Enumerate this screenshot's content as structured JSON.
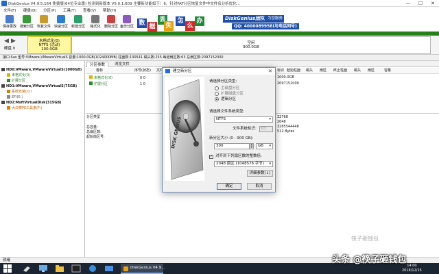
{
  "window": {
    "title": "DiskGenius V4.9.5.164 免费版(64位专业版) 检测到新版本 V5.0.1.609 主要新功能如下：6、针对FAT分区恢复文件中文件名分析优化…",
    "minimize": "—",
    "maximize": "☐",
    "close": "✕"
  },
  "menu": [
    "文件(F)",
    "硬盘(D)",
    "分区(P)",
    "工具(T)",
    "查看(V)",
    "帮助(H)"
  ],
  "toolbar": [
    {
      "label": "保存更改",
      "icon": "save-icon",
      "color": "#4a7bd0"
    },
    {
      "label": "搜索分区",
      "icon": "search-icon",
      "color": "#3a9a3a"
    },
    {
      "label": "恢复文件",
      "icon": "recover-icon",
      "color": "#c89a2a"
    },
    {
      "label": "快速分区",
      "icon": "quick-partition-icon",
      "color": "#2c7fd0"
    },
    {
      "label": "新建分区",
      "icon": "new-partition-icon",
      "color": "#2ca06a"
    },
    {
      "label": "格式化",
      "icon": "format-icon",
      "color": "#777777"
    },
    {
      "label": "删除分区",
      "icon": "delete-icon",
      "color": "#d04040"
    },
    {
      "label": "备份分区",
      "icon": "backup-icon",
      "color": "#8a5ac0"
    }
  ],
  "banner": {
    "chars": [
      "数",
      "据",
      "丢",
      "失",
      "怎",
      "么",
      "办"
    ],
    "char_colors": [
      "#1e4bb0",
      "#d22a2a",
      "#1e8a3a",
      "#e0a010",
      "#1e4bb0",
      "#d22a2a",
      "#1e8a3a"
    ],
    "brand": "DiskGenius团队",
    "slogan": "为您服务",
    "qq": "QQ: 4000089958(与电话同号)"
  },
  "diskbar": {
    "label": "硬盘 0",
    "partition_used": {
      "line1": "未格式化(0)",
      "line2": "NTFS (活动)",
      "line3": "100.0GB"
    },
    "partition_free": {
      "line1": "空闲",
      "line2": "900.0GB"
    },
    "info": "接口:Sas  型号:VMware,VMwareVirtualS  容量:1000.0GB(1024000MB)  柱面数:130541  磁头数:255  每道扇区数:63  总扇区数:2097152000"
  },
  "tree": [
    {
      "text": "HD0:VMware,VMwareVirtualS(1000GB)",
      "indent": 0,
      "color": "#111111",
      "bold": true
    },
    {
      "text": "未格式化(0)",
      "indent": 1,
      "color": "#2a7a2a",
      "bold": false
    },
    {
      "text": "扩展分区",
      "indent": 1,
      "color": "#2a7a2a",
      "bold": false
    },
    {
      "text": "HD1:VMware,VMwareVirtualS(75GB)",
      "indent": 0,
      "color": "#111111",
      "bold": true
    },
    {
      "text": "系统安装(D:)",
      "indent": 1,
      "color": "#c06000",
      "bold": false
    },
    {
      "text": "EFI(E:)",
      "indent": 1,
      "color": "#555555",
      "bold": false
    },
    {
      "text": "HD2:MsftVirtualDisk(315GB)",
      "indent": 0,
      "color": "#111111",
      "bold": true
    },
    {
      "text": "大白菜PE工具盘(F:)",
      "indent": 1,
      "color": "#c06000",
      "bold": false
    }
  ],
  "rtabs": [
    "分区参数",
    "浏览文件"
  ],
  "columns": [
    "卷标",
    "序号(状态)",
    "文件系统",
    "标识",
    "起始柱面",
    "磁头",
    "扇区",
    "终止柱面",
    "磁头",
    "扇区",
    "容量"
  ],
  "partitions": [
    {
      "name": "未格式化(0)",
      "seq": "0 0",
      "color": "#2a7a2a"
    },
    {
      "name": "扩展分区",
      "seq": "1 0",
      "color": "#2a7a2a"
    }
  ],
  "lower": {
    "keys": [
      "分区类型",
      "",
      "总容量:",
      "总扇区数:",
      "起始扇区号:"
    ],
    "right": [
      "1000.0GB",
      "2097152000",
      "32768",
      "2048",
      "3285544448",
      "512 Bytes"
    ]
  },
  "status": "就绪",
  "taskbar": {
    "app": "DiskGenius V4.9...",
    "time": "14:00",
    "date": "2018/12/15"
  },
  "dialog": {
    "title": "建立新分区",
    "close": "✕",
    "art_text": "DISK GENIUS",
    "section1": "请选择分区类型:",
    "radios": [
      {
        "label": "主磁盘分区",
        "checked": false
      },
      {
        "label": "扩展磁盘分区",
        "checked": false
      },
      {
        "label": "逻辑分区",
        "checked": true
      }
    ],
    "section2": "请选择文件系统类型:",
    "fs_value": "NTFS",
    "fs_id_label": "文件系统标识:",
    "fs_id_value": "07",
    "size_label": "新分区大小 (0 - 900 GB):",
    "size_value": "300",
    "size_unit": "GB",
    "align_label": "对齐到下列扇区数的整数倍:",
    "align_checked": true,
    "align_value": "2048 扇区 (1048576 字节)",
    "detail_button": "详细参数(↓)",
    "ok": "确定",
    "cancel": "取消"
  },
  "watermark": {
    "main": "头条 @筷子砸钱包",
    "top": "筷子砸钱包"
  }
}
